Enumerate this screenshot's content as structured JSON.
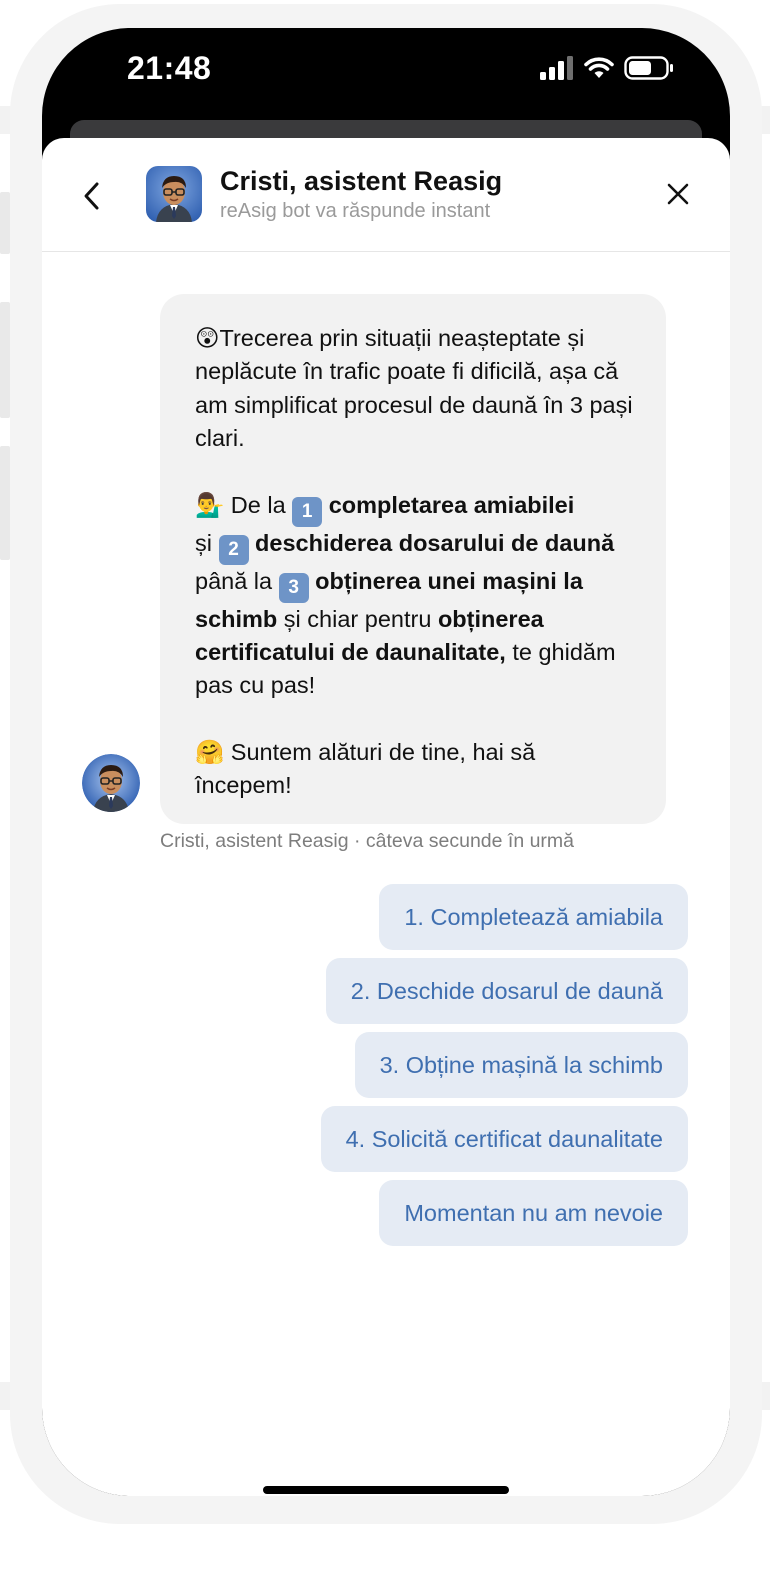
{
  "status_bar": {
    "time": "21:48"
  },
  "header": {
    "title": "Cristi, asistent Reasig",
    "subtitle": "reAsig bot va răspunde instant"
  },
  "message": {
    "p1_emoji": "😲",
    "p1_text": "Trecerea prin situații neașteptate și neplăcute în trafic poate fi dificilă, așa că am simplificat procesul de daună în 3 pași clari.",
    "p2_emoji": "💁‍♂️",
    "p2_de_la": " De la ",
    "key1": "1",
    "step1": "completarea amiabilei",
    "p2_si": "și ",
    "key2": "2",
    "step2": "deschiderea dosarului de daună",
    "p2_pana_la": " până la ",
    "key3": "3",
    "step3": "obținerea unei mașini la schimb",
    "p2_si_chiar": " și chiar pentru ",
    "step4": "obținerea certificatului de daunalitate,",
    "p2_end": " te ghidăm pas cu pas!",
    "p3_emoji": "🤗",
    "p3_text": " Suntem alături de tine, hai să începem!"
  },
  "message_meta": "Cristi, asistent Reasig · câteva secunde în urmă",
  "quick_replies": [
    "1. Completează amiabila",
    "2. Deschide dosarul de daună",
    "3. Obține mașină la schimb",
    "4. Solicită certificat daunalitate",
    "Momentan nu am nevoie"
  ],
  "colors": {
    "accent": "#3f6fb0",
    "quick_reply_bg": "#e5ebf4",
    "bubble_bg": "#f2f2f2"
  },
  "icons": [
    "back-chevron-icon",
    "close-icon",
    "signal-icon",
    "wifi-icon",
    "battery-icon"
  ]
}
